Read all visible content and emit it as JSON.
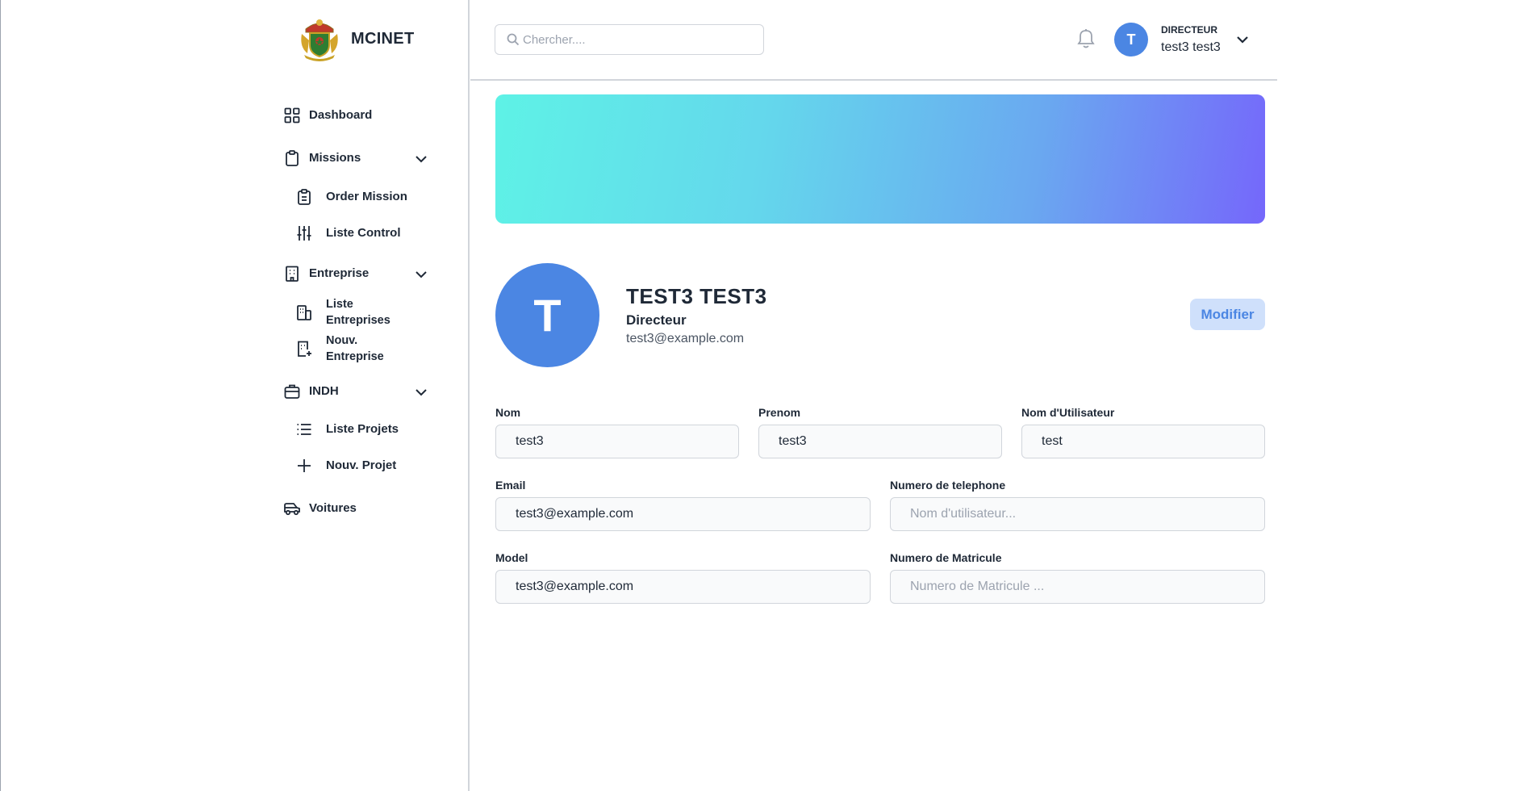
{
  "brand": {
    "name": "MCINET"
  },
  "sidebar": {
    "items": [
      {
        "label": "Dashboard",
        "icon": "dashboard-icon"
      },
      {
        "label": "Missions",
        "icon": "clipboard-icon",
        "expandable": true
      },
      {
        "label": "Order Mission",
        "icon": "clipboard-list-icon"
      },
      {
        "label": "Liste Control",
        "icon": "sliders-icon"
      },
      {
        "label": "Entreprise",
        "icon": "building-icon",
        "expandable": true
      },
      {
        "label": "Liste Entreprises",
        "icon": "buildings-icon"
      },
      {
        "label": "Nouv. Entreprise",
        "icon": "building-add-icon"
      },
      {
        "label": "INDH",
        "icon": "briefcase-icon",
        "expandable": true
      },
      {
        "label": "Liste Projets",
        "icon": "list-icon"
      },
      {
        "label": "Nouv. Projet",
        "icon": "plus-icon"
      },
      {
        "label": "Voitures",
        "icon": "car-icon"
      }
    ]
  },
  "header": {
    "search_placeholder": "Chercher....",
    "user": {
      "initial": "T",
      "role": "DIRECTEUR",
      "name": "test3 test3"
    }
  },
  "profile": {
    "initial": "T",
    "name": "TEST3 TEST3",
    "role": "Directeur",
    "email": "test3@example.com",
    "modify_label": "Modifier"
  },
  "form": {
    "nom": {
      "label": "Nom",
      "value": "test3"
    },
    "prenom": {
      "label": "Prenom",
      "value": "test3"
    },
    "username": {
      "label": "Nom d'Utilisateur",
      "value": "test"
    },
    "email": {
      "label": "Email",
      "value": "test3@example.com"
    },
    "phone": {
      "label": "Numero de telephone",
      "placeholder": "Nom d'utilisateur..."
    },
    "model": {
      "label": "Model",
      "value": "test3@example.com"
    },
    "matricule": {
      "label": "Numero de Matricule",
      "placeholder": "Numero de Matricule ..."
    }
  },
  "colors": {
    "accent": "#4b86e3",
    "accent_light": "#cfe0fb",
    "banner_start": "#5ef2e6",
    "banner_end": "#7567fb"
  }
}
